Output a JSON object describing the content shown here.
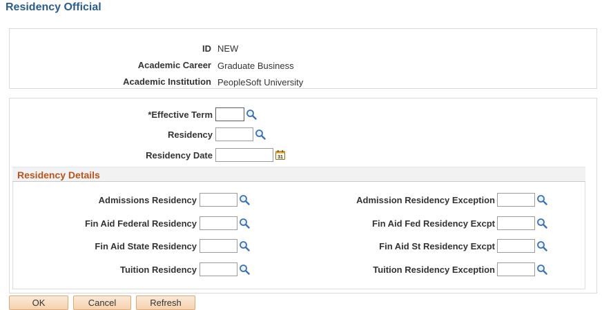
{
  "page": {
    "title": "Residency Official"
  },
  "key_info": {
    "id_label": "ID",
    "id_value": "NEW",
    "career_label": "Academic Career",
    "career_value": "Graduate Business",
    "institution_label": "Academic Institution",
    "institution_value": "PeopleSoft University"
  },
  "form": {
    "effective_term_label": "*Effective Term",
    "effective_term_value": "",
    "residency_label": "Residency",
    "residency_value": "",
    "residency_date_label": "Residency Date",
    "residency_date_value": ""
  },
  "details": {
    "title": "Residency Details",
    "left": [
      {
        "label": "Admissions Residency",
        "value": ""
      },
      {
        "label": "Fin Aid Federal Residency",
        "value": ""
      },
      {
        "label": "Fin Aid State Residency",
        "value": ""
      },
      {
        "label": "Tuition Residency",
        "value": ""
      }
    ],
    "right": [
      {
        "label": "Admission Residency Exception",
        "value": ""
      },
      {
        "label": "Fin Aid Fed Residency Excpt",
        "value": ""
      },
      {
        "label": "Fin Aid St Residency Excpt",
        "value": ""
      },
      {
        "label": "Tuition Residency Exception",
        "value": ""
      }
    ]
  },
  "buttons": {
    "ok": "OK",
    "cancel": "Cancel",
    "refresh": "Refresh"
  },
  "calendar_icon_text": "31",
  "colors": {
    "title": "#2a5d8f",
    "section_title": "#b5541c",
    "button": "#f6d2ae"
  }
}
